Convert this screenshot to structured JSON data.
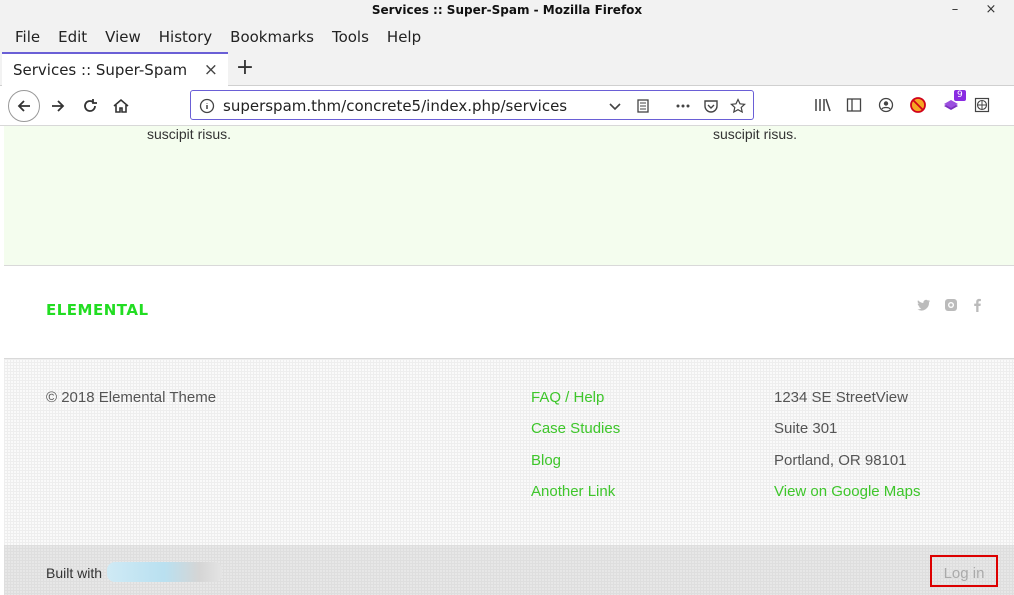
{
  "window": {
    "title": "Services :: Super-Spam - Mozilla Firefox",
    "minimize": "–",
    "close": "×"
  },
  "menu": [
    "File",
    "Edit",
    "View",
    "History",
    "Bookmarks",
    "Tools",
    "Help"
  ],
  "tab": {
    "label": "Services :: Super-Spam",
    "close": "×",
    "new_tab": "+"
  },
  "nav": {
    "url": "superspam.thm/concrete5/index.php/services",
    "extension_badge": "9"
  },
  "page": {
    "top_text_left": "suscipit risus.",
    "top_text_right": "suscipit risus.",
    "logo": "ELEMENTAL",
    "copyright": "© 2018 Elemental Theme",
    "links": [
      "FAQ / Help",
      "Case Studies",
      "Blog",
      "Another Link"
    ],
    "address": [
      "1234 SE StreetView",
      "Suite 301",
      "Portland, OR 98101"
    ],
    "map_link": "View on Google Maps",
    "built_with": "Built with",
    "login": "Log in"
  },
  "colors": {
    "accent": "#6a5fd6",
    "green": "#3ec62b",
    "logo_green": "#22dd22",
    "highlight": "#dd0000"
  }
}
